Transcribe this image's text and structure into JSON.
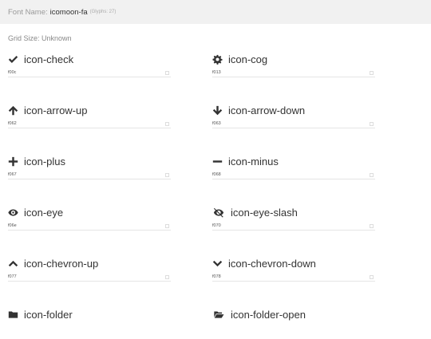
{
  "header": {
    "prefix": "Font Name:",
    "font_name": "icomoon-fa",
    "glyph_count": "(Glyphs: 27)"
  },
  "grid_size": "Grid Size: Unknown",
  "icons": [
    {
      "name": "icon-check",
      "code": "f00c",
      "icon": "check-icon"
    },
    {
      "name": "icon-cog",
      "code": "f013",
      "icon": "cog-icon"
    },
    {
      "name": "icon-arrow-up",
      "code": "f062",
      "icon": "arrow-up-icon"
    },
    {
      "name": "icon-arrow-down",
      "code": "f063",
      "icon": "arrow-down-icon"
    },
    {
      "name": "icon-plus",
      "code": "f067",
      "icon": "plus-icon"
    },
    {
      "name": "icon-minus",
      "code": "f068",
      "icon": "minus-icon"
    },
    {
      "name": "icon-eye",
      "code": "f06e",
      "icon": "eye-icon"
    },
    {
      "name": "icon-eye-slash",
      "code": "f070",
      "icon": "eye-slash-icon"
    },
    {
      "name": "icon-chevron-up",
      "code": "f077",
      "icon": "chevron-up-icon"
    },
    {
      "name": "icon-chevron-down",
      "code": "f078",
      "icon": "chevron-down-icon"
    },
    {
      "name": "icon-folder",
      "code": "",
      "icon": "folder-icon"
    },
    {
      "name": "icon-folder-open",
      "code": "",
      "icon": "folder-open-icon"
    }
  ]
}
